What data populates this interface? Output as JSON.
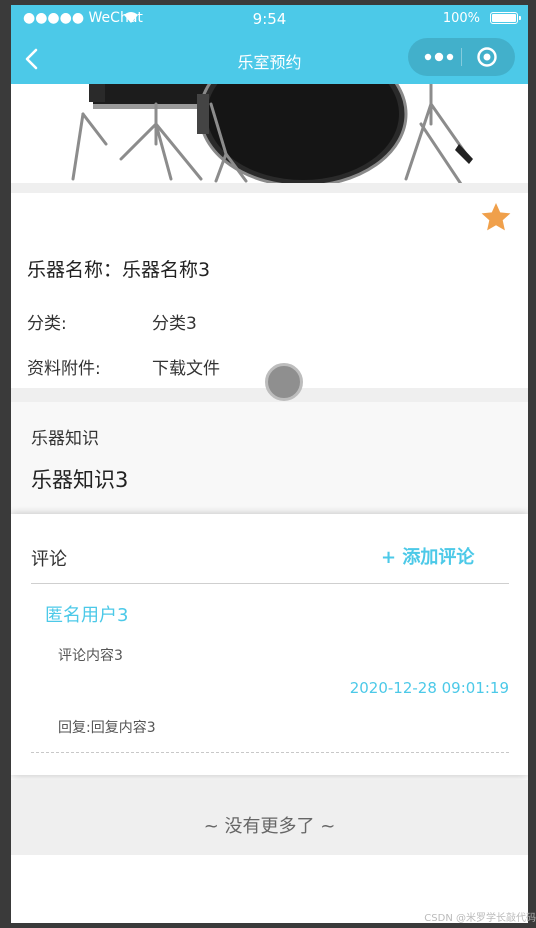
{
  "status_bar": {
    "carrier": "●●●●● WeChat",
    "time": "9:54",
    "battery": "100%"
  },
  "nav": {
    "title": "乐室预约"
  },
  "instrument": {
    "name_label": "乐器名称：",
    "name_value": "乐器名称3",
    "category_label": "分类:",
    "category_value": "分类3",
    "attachment_label": "资料附件:",
    "attachment_value": "下载文件",
    "favorite_color": "#f0a04b"
  },
  "knowledge": {
    "title": "乐器知识",
    "content": "乐器知识3"
  },
  "comments": {
    "title": "评论",
    "add_label": "+ 添加评论",
    "items": [
      {
        "user": "匿名用户3",
        "content": "评论内容3",
        "date": "2020-12-28 09:01:19",
        "reply": "回复:回复内容3"
      }
    ]
  },
  "footer": {
    "no_more": "~ 没有更多了 ~"
  },
  "watermark": "CSDN @米罗学长敲代码",
  "colors": {
    "accent": "#4cc9e8",
    "star": "#f0a04b"
  }
}
